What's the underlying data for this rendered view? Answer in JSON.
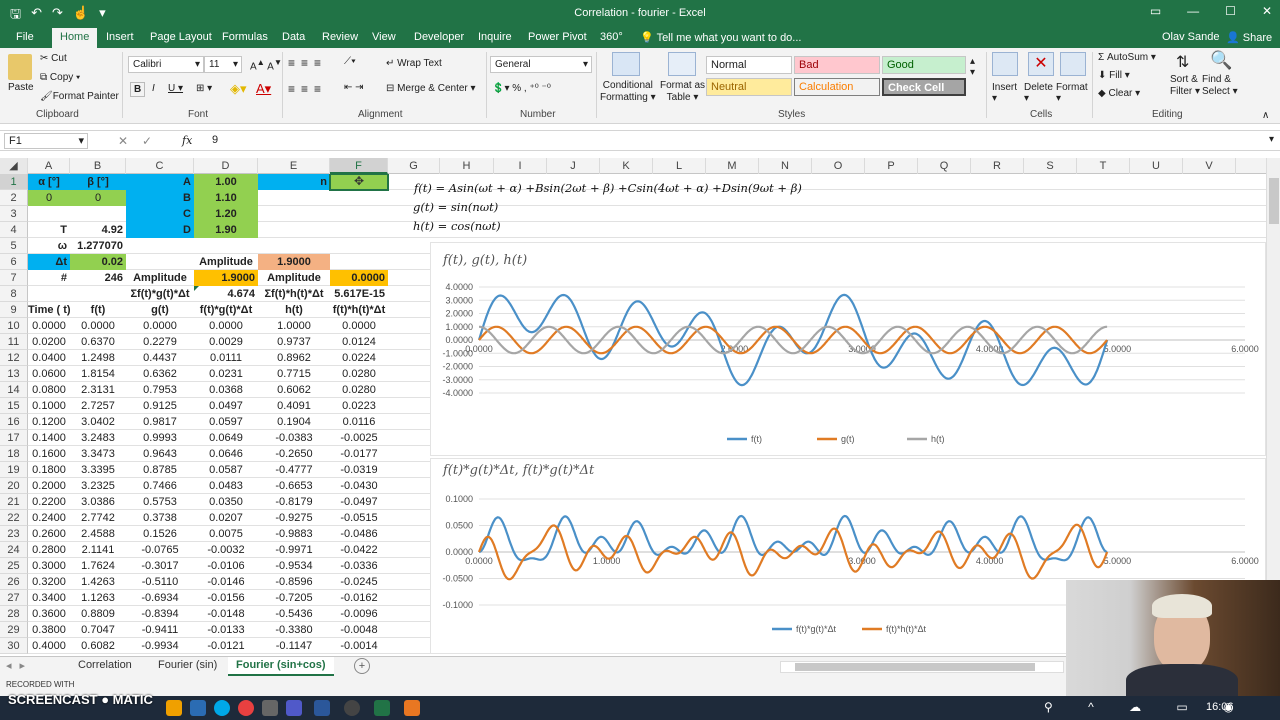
{
  "window": {
    "title": "Correlation - fourier - Excel",
    "user": "Olav Sande",
    "share": "Share"
  },
  "tabs": [
    "File",
    "Home",
    "Insert",
    "Page Layout",
    "Formulas",
    "Data",
    "Review",
    "View",
    "Developer",
    "Inquire",
    "Power Pivot",
    "360°",
    "Tell me what you want to do..."
  ],
  "ribbon": {
    "clipboard": {
      "paste": "Paste",
      "cut": "Cut",
      "copy": "Copy",
      "format_painter": "Format Painter",
      "label": "Clipboard"
    },
    "font": {
      "name": "Calibri",
      "size": "11",
      "label": "Font"
    },
    "alignment": {
      "wrap": "Wrap Text",
      "merge": "Merge & Center",
      "label": "Alignment"
    },
    "number": {
      "format": "General",
      "label": "Number"
    },
    "styles": {
      "conditional": "Conditional",
      "formatting": "Formatting",
      "format_as": "Format as",
      "table": "Table",
      "normal": "Normal",
      "bad": "Bad",
      "good": "Good",
      "neutral": "Neutral",
      "calculation": "Calculation",
      "check_cell": "Check Cell",
      "label": "Styles"
    },
    "cells": {
      "insert": "Insert",
      "delete": "Delete",
      "format": "Format",
      "label": "Cells"
    },
    "editing": {
      "autosum": "AutoSum",
      "fill": "Fill",
      "clear": "Clear",
      "sort": "Sort &",
      "filter": "Filter",
      "find": "Find &",
      "select": "Select",
      "label": "Editing"
    }
  },
  "formula_bar": {
    "name_box": "F1",
    "fx": "fx",
    "value": "9"
  },
  "columns": [
    "A",
    "B",
    "C",
    "D",
    "E",
    "F",
    "G",
    "H",
    "I",
    "J",
    "K",
    "L",
    "M",
    "N",
    "O",
    "P",
    "Q",
    "R",
    "S",
    "T",
    "U",
    "V"
  ],
  "rows": [
    "1",
    "2",
    "3",
    "4",
    "5",
    "6",
    "7",
    "8",
    "9",
    "10",
    "11",
    "12",
    "13",
    "14",
    "15",
    "16",
    "17",
    "18",
    "19",
    "20",
    "21",
    "22",
    "23",
    "24",
    "25",
    "26",
    "27",
    "28",
    "29",
    "30"
  ],
  "cells": {
    "A1": "α [°]",
    "B1": "β [°]",
    "C1": "A",
    "D1": "1.00",
    "E1": "n",
    "A2": "0",
    "B2": "0",
    "C2": "B",
    "D2": "1.10",
    "C3": "C",
    "D3": "1.20",
    "A4": "T",
    "B4": "4.92",
    "C4": "D",
    "D4": "1.90",
    "A5": "ω",
    "B5": "1.277070",
    "A6": "Δt",
    "B6": "0.02",
    "D6": "Amplitude",
    "E6": "1.9000",
    "A7": "#",
    "B7": "246",
    "C7": "Amplitude",
    "D7": "1.9000",
    "E7": "Amplitude",
    "F7": "0.0000",
    "C8": "Σf(t)*g(t)*Δt",
    "D8": "4.674",
    "E8": "Σf(t)*h(t)*Δt",
    "F8": "5.617E-15",
    "A9": "Time ( t)",
    "B9": "f(t)",
    "C9": "g(t)",
    "D9": "f(t)*g(t)*Δt",
    "E9": "h(t)",
    "F9": "f(t)*h(t)*Δt"
  },
  "table": [
    [
      "0.0000",
      "0.0000",
      "0.0000",
      "0.0000",
      "1.0000",
      "0.0000"
    ],
    [
      "0.0200",
      "0.6370",
      "0.2279",
      "0.0029",
      "0.9737",
      "0.0124"
    ],
    [
      "0.0400",
      "1.2498",
      "0.4437",
      "0.0111",
      "0.8962",
      "0.0224"
    ],
    [
      "0.0600",
      "1.8154",
      "0.6362",
      "0.0231",
      "0.7715",
      "0.0280"
    ],
    [
      "0.0800",
      "2.3131",
      "0.7953",
      "0.0368",
      "0.6062",
      "0.0280"
    ],
    [
      "0.1000",
      "2.7257",
      "0.9125",
      "0.0497",
      "0.4091",
      "0.0223"
    ],
    [
      "0.1200",
      "3.0402",
      "0.9817",
      "0.0597",
      "0.1904",
      "0.0116"
    ],
    [
      "0.1400",
      "3.2483",
      "0.9993",
      "0.0649",
      "-0.0383",
      "-0.0025"
    ],
    [
      "0.1600",
      "3.3473",
      "0.9643",
      "0.0646",
      "-0.2650",
      "-0.0177"
    ],
    [
      "0.1800",
      "3.3395",
      "0.8785",
      "0.0587",
      "-0.4777",
      "-0.0319"
    ],
    [
      "0.2000",
      "3.2325",
      "0.7466",
      "0.0483",
      "-0.6653",
      "-0.0430"
    ],
    [
      "0.2200",
      "3.0386",
      "0.5753",
      "0.0350",
      "-0.8179",
      "-0.0497"
    ],
    [
      "0.2400",
      "2.7742",
      "0.3738",
      "0.0207",
      "-0.9275",
      "-0.0515"
    ],
    [
      "0.2600",
      "2.4588",
      "0.1526",
      "0.0075",
      "-0.9883",
      "-0.0486"
    ],
    [
      "0.2800",
      "2.1141",
      "-0.0765",
      "-0.0032",
      "-0.9971",
      "-0.0422"
    ],
    [
      "0.3000",
      "1.7624",
      "-0.3017",
      "-0.0106",
      "-0.9534",
      "-0.0336"
    ],
    [
      "0.3200",
      "1.4263",
      "-0.5110",
      "-0.0146",
      "-0.8596",
      "-0.0245"
    ],
    [
      "0.3400",
      "1.1263",
      "-0.6934",
      "-0.0156",
      "-0.7205",
      "-0.0162"
    ],
    [
      "0.3600",
      "0.8809",
      "-0.8394",
      "-0.0148",
      "-0.5436",
      "-0.0096"
    ],
    [
      "0.3800",
      "0.7047",
      "-0.9411",
      "-0.0133",
      "-0.3380",
      "-0.0048"
    ],
    [
      "0.4000",
      "0.6082",
      "-0.9934",
      "-0.0121",
      "-0.1147",
      "-0.0014"
    ]
  ],
  "formulas": [
    "f(t) = Asin(ωt + α) +Bsin(2ωt + β) +Csin(4ωt + α) +Dsin(9ωt + β)",
    "g(t) = sin(nωt)",
    "h(t) = cos(nωt)"
  ],
  "colors": {
    "blue": "#4a90c8",
    "orange": "#e07b24",
    "gray": "#a6a6a6",
    "cyan_fill": "#00b0f0",
    "green_fill": "#92d050",
    "orange_fill": "#ffc000",
    "salmon_fill": "#f4b183",
    "excel_green": "#217346"
  },
  "chart_data": [
    {
      "type": "line",
      "title": "f(t), g(t), h(t)",
      "xlim": [
        0,
        6
      ],
      "ylim": [
        -4,
        4
      ],
      "x_ticks": [
        "0.0000",
        "2.0000",
        "3.0000",
        "4.0000",
        "5.0000",
        "6.0000"
      ],
      "y_ticks": [
        "4.0000",
        "3.0000",
        "2.0000",
        "1.0000",
        "0.0000",
        "-1.0000",
        "-2.0000",
        "-3.0000",
        "-4.0000"
      ],
      "legend": "bottom",
      "series": [
        {
          "name": "f(t)",
          "color": "#4a90c8"
        },
        {
          "name": "g(t)",
          "color": "#e07b24"
        },
        {
          "name": "h(t)",
          "color": "#a6a6a6"
        }
      ],
      "params": {
        "A": 1.0,
        "B": 1.1,
        "C": 1.2,
        "D": 1.9,
        "omega": 1.27707,
        "n": 9,
        "t_end": 4.92
      }
    },
    {
      "type": "line",
      "title": "f(t)*g(t)*Δt, f(t)*g(t)*Δt",
      "xlim": [
        0,
        6
      ],
      "ylim": [
        -0.1,
        0.1
      ],
      "x_ticks": [
        "0.0000",
        "1.0000",
        "3.0000",
        "4.0000",
        "5.0000",
        "6.0000"
      ],
      "y_ticks": [
        "0.1000",
        "0.0500",
        "0.0000",
        "-0.0500",
        "-0.1000"
      ],
      "legend": "bottom",
      "series": [
        {
          "name": "f(t)*g(t)*Δt",
          "color": "#4a90c8"
        },
        {
          "name": "f(t)*h(t)*Δt",
          "color": "#e07b24"
        }
      ]
    }
  ],
  "sheets": [
    "Correlation",
    "Fourier (sin)",
    "Fourier (sin+cos)"
  ],
  "status": {
    "recorded": "RECORDED WITH",
    "brand": "SCREENCAST",
    "brand2": "MATIC"
  },
  "taskbar": {
    "time": "16:06"
  }
}
